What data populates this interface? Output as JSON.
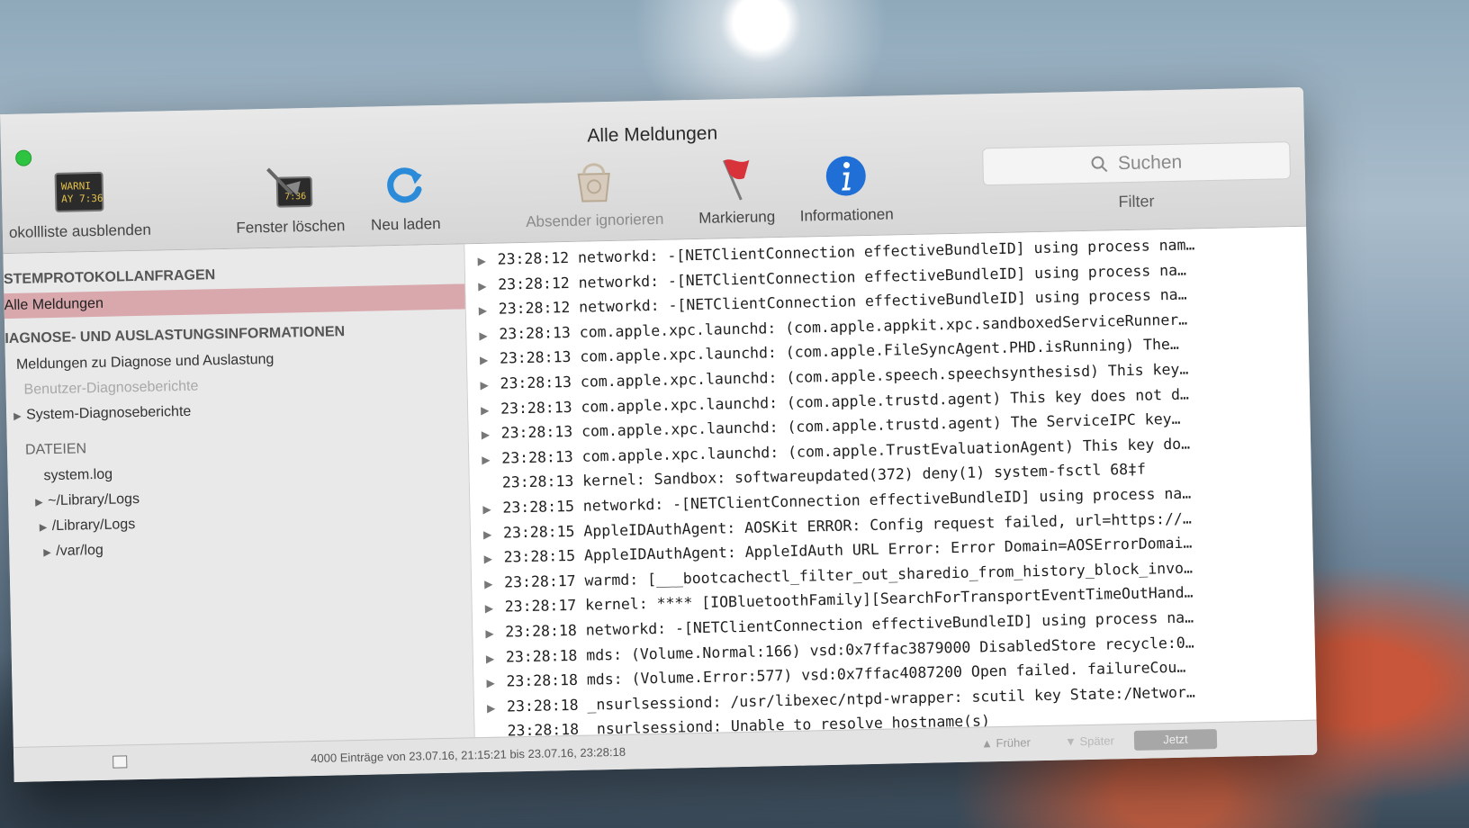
{
  "window": {
    "title": "Alle Meldungen"
  },
  "toolbar": {
    "hide_list_label": "okollliste ausblenden",
    "clear_label": "Fenster löschen",
    "reload_label": "Neu laden",
    "ignore_sender_label": "Absender ignorieren",
    "mark_label": "Markierung",
    "info_label": "Informationen",
    "search_placeholder": "Suchen",
    "filter_label": "Filter",
    "console_icon_text_1": "WARNI",
    "console_icon_text_2": "AY 7:36",
    "clear_icon_text": "7:36"
  },
  "sidebar": {
    "section_system": "STEMPROTOKOLLANFRAGEN",
    "item_all_messages": "Alle Meldungen",
    "section_diagnose": "IAGNOSE- UND AUSLASTUNGSINFORMATIONEN",
    "item_diagnose_messages": "Meldungen zu Diagnose und Auslastung",
    "item_user_reports": "Benutzer-Diagnoseberichte",
    "item_system_reports": "System-Diagnoseberichte",
    "section_files": "DATEIEN",
    "item_system_log": "system.log",
    "item_user_library_logs": "~/Library/Logs",
    "item_library_logs": "/Library/Logs",
    "item_var_log": "/var/log"
  },
  "log": {
    "rows": [
      {
        "text": "23:28:12 networkd: -[NETClientConnection effectiveBundleID] using process nam…",
        "expandable": true
      },
      {
        "text": "23:28:12 networkd: -[NETClientConnection effectiveBundleID] using process na…",
        "expandable": true
      },
      {
        "text": "23:28:12 networkd: -[NETClientConnection effectiveBundleID] using process na…",
        "expandable": true
      },
      {
        "text": "23:28:13 com.apple.xpc.launchd: (com.apple.appkit.xpc.sandboxedServiceRunner…",
        "expandable": true
      },
      {
        "text": "23:28:13 com.apple.xpc.launchd: (com.apple.FileSyncAgent.PHD.isRunning) The…",
        "expandable": true
      },
      {
        "text": "23:28:13 com.apple.xpc.launchd: (com.apple.speech.speechsynthesisd) This key…",
        "expandable": true
      },
      {
        "text": "23:28:13 com.apple.xpc.launchd: (com.apple.trustd.agent) This key does not d…",
        "expandable": true
      },
      {
        "text": "23:28:13 com.apple.xpc.launchd: (com.apple.trustd.agent) The ServiceIPC key…",
        "expandable": true
      },
      {
        "text": "23:28:13 com.apple.xpc.launchd: (com.apple.TrustEvaluationAgent) This key do…",
        "expandable": true
      },
      {
        "text": "23:28:13 kernel: Sandbox: softwareupdated(372) deny(1) system-fsctl 68‡f",
        "expandable": false
      },
      {
        "text": "23:28:15 networkd: -[NETClientConnection effectiveBundleID] using process na…",
        "expandable": true
      },
      {
        "text": "23:28:15 AppleIDAuthAgent: AOSKit ERROR: Config request failed, url=https://…",
        "expandable": true
      },
      {
        "text": "23:28:15 AppleIDAuthAgent: AppleIdAuth URL Error: Error Domain=AOSErrorDomai…",
        "expandable": true
      },
      {
        "text": "23:28:17 warmd: [___bootcachectl_filter_out_sharedio_from_history_block_invo…",
        "expandable": true
      },
      {
        "text": "23:28:17 kernel: **** [IOBluetoothFamily][SearchForTransportEventTimeOutHand…",
        "expandable": true
      },
      {
        "text": "23:28:18 networkd: -[NETClientConnection effectiveBundleID] using process na…",
        "expandable": true
      },
      {
        "text": "23:28:18 mds: (Volume.Normal:166) vsd:0x7ffac3879000 DisabledStore recycle:0…",
        "expandable": true
      },
      {
        "text": "23:28:18 mds: (Volume.Error:577) vsd:0x7ffac4087200 Open failed.  failureCou…",
        "expandable": true
      },
      {
        "text": "23:28:18 _nsurlsessiond: /usr/libexec/ntpd-wrapper: scutil key State:/Networ…",
        "expandable": true
      },
      {
        "text": "23:28:18 _nsurlsessiond: Unable to resolve hostname(s)",
        "expandable": false
      }
    ]
  },
  "status": {
    "summary": "4000 Einträge von 23.07.16, 21:15:21 bis 23.07.16, 23:28:18",
    "earlier_label": "Früher",
    "later_label": "Später",
    "now_label": "Jetzt"
  },
  "colors": {
    "selection": "#d9a8ad",
    "info_blue": "#1f6fd6",
    "reload_blue": "#2b8bd9",
    "flag_red": "#d8333a",
    "traffic_green": "#2ec441"
  }
}
